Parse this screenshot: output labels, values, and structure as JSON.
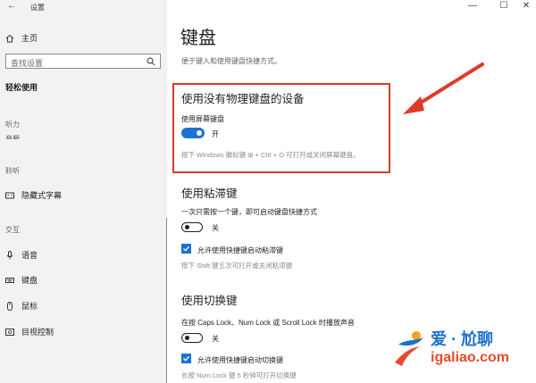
{
  "window": {
    "title": "设置",
    "controls": {
      "minimize": "—",
      "maximize": "☐",
      "close": "✕"
    }
  },
  "sidebar": {
    "home": "主页",
    "search_placeholder": "查找设置",
    "category": "轻松使用",
    "sections": {
      "hearing": "听力",
      "hearing_item_partial": "音频",
      "vision_partial": "聆听",
      "captions": "隐藏式字幕",
      "interaction": "交互",
      "items": [
        {
          "label": "语音",
          "icon": "microphone-icon"
        },
        {
          "label": "键盘",
          "icon": "keyboard-icon"
        },
        {
          "label": "鼠标",
          "icon": "mouse-icon"
        },
        {
          "label": "目视控制",
          "icon": "eye-control-icon"
        }
      ]
    }
  },
  "main": {
    "title": "键盘",
    "subtitle": "便于键入和使用键盘快捷方式。",
    "osk": {
      "heading": "使用没有物理键盘的设备",
      "label": "使用屏幕键盘",
      "state": "开",
      "hint": "按下 Windows 徽标键 ⊞ + Ctrl + O 可打开或关闭屏幕键盘。"
    },
    "sticky": {
      "heading": "使用粘滞键",
      "desc": "一次只需按一个键，即可启动键盘快捷方式",
      "state": "关",
      "checkbox": "允许使用快捷键启动粘滞键",
      "hint": "按下 Shift 键五次可打开或关闭粘滞键"
    },
    "toggle_keys": {
      "heading": "使用切换键",
      "desc": "在按 Caps Lock、Num Lock 或 Scroll Lock 时播放声音",
      "state": "关",
      "checkbox": "允许使用快捷键启动切换键",
      "hint": "长按 Num Lock 键 5 秒钟可打开切换键"
    }
  },
  "watermark": {
    "brand": "爱 · 尬聊",
    "domain": "igaliao.com"
  },
  "colors": {
    "accent": "#1a73d1",
    "highlight": "#d83a2c",
    "sidebar_bg": "#f2f2f2"
  }
}
